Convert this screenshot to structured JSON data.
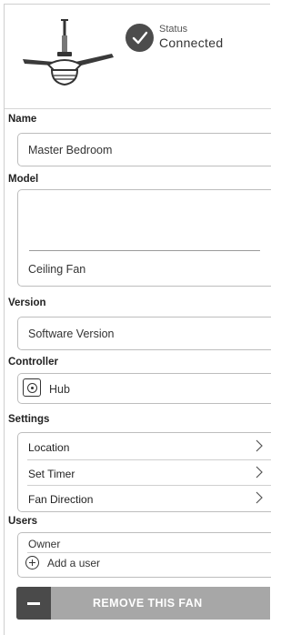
{
  "device": {
    "icon": "ceiling-fan-icon",
    "status_icon": "checkmark-circle-icon",
    "status_label": "Status",
    "status_value": "Connected"
  },
  "name_section": {
    "title": "Name",
    "value": "Master Bedroom"
  },
  "model_section": {
    "title": "Model",
    "value": "Ceiling Fan"
  },
  "version_section": {
    "title": "Version",
    "value": "Software Version"
  },
  "controller_section": {
    "title": "Controller",
    "value": "Hub",
    "icon": "hub-icon"
  },
  "settings_section": {
    "title": "Settings",
    "items": [
      {
        "label": "Location",
        "icon": "chevron-right-icon"
      },
      {
        "label": "Set Timer",
        "icon": "chevron-right-icon"
      },
      {
        "label": "Fan Direction",
        "icon": "chevron-right-icon"
      }
    ]
  },
  "users_section": {
    "title": "Users",
    "owner": "Owner",
    "add_user_label": "Add a user",
    "add_icon": "plus-circle-icon"
  },
  "remove_button": {
    "label": "REMOVE THIS FAN",
    "icon": "minus-icon"
  },
  "colors": {
    "dark_gray": "#4a4a4a",
    "button_gray": "#a7a7a7",
    "border": "#bdbdbd"
  }
}
